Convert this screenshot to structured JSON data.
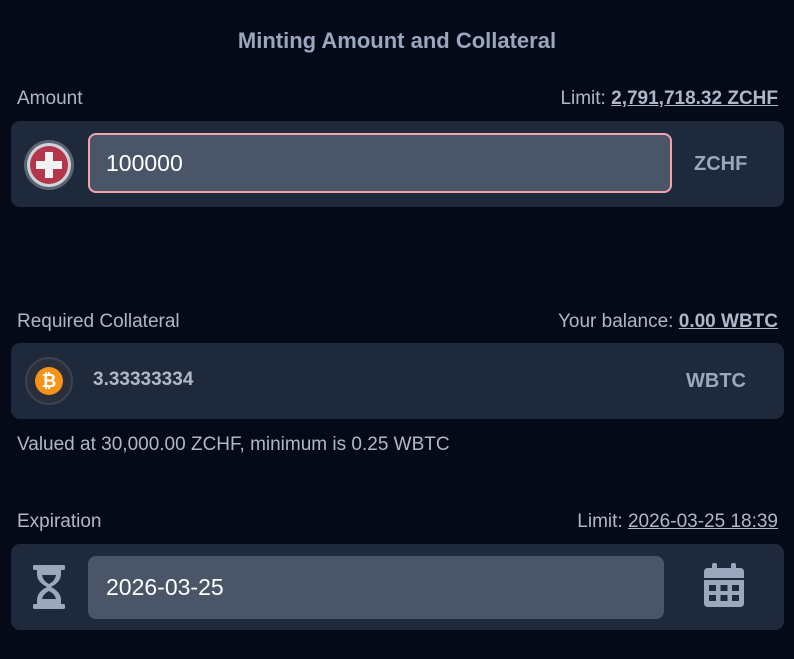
{
  "section_title": "Minting Amount and Collateral",
  "amount": {
    "label": "Amount",
    "limit_prefix": "Limit:",
    "limit_value": "2,791,718.32 ZCHF",
    "input_value": "100000",
    "currency": "ZCHF",
    "token_icon": "swiss-franc-coin-icon"
  },
  "collateral": {
    "label": "Required Collateral",
    "balance_prefix": "Your balance:",
    "balance_value": "0.00 WBTC",
    "value": "3.33333334",
    "currency": "WBTC",
    "token_icon": "bitcoin-icon",
    "note": "Valued at 30,000.00 ZCHF, minimum is 0.25 WBTC"
  },
  "expiration": {
    "label": "Expiration",
    "limit_prefix": "Limit:",
    "limit_value": "2026-03-25 18:39",
    "input_value": "2026-03-25",
    "left_icon": "hourglass-icon",
    "right_icon": "calendar-icon"
  },
  "colors": {
    "background": "#050a19",
    "card": "#1e293b",
    "input": "#4a5568",
    "input_border_active": "#f3a3ad",
    "bitcoin": "#f7931a",
    "swiss_red": "#b3364a"
  }
}
